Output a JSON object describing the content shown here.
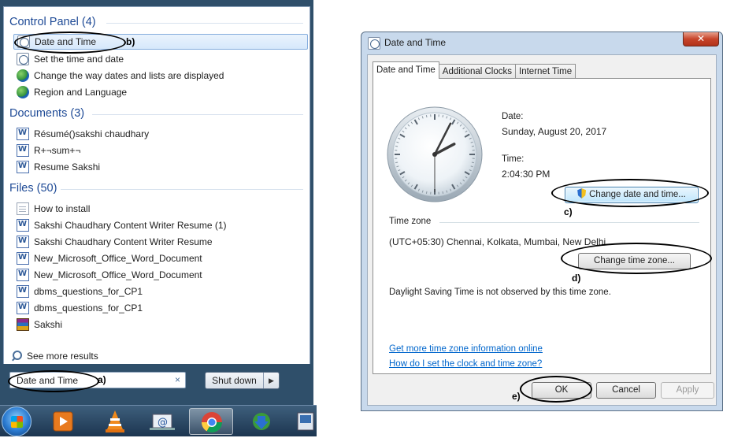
{
  "start_menu": {
    "sections": {
      "control_panel": {
        "heading": "Control Panel (4)",
        "items": [
          {
            "label": "Date and Time",
            "icon": "clock-icon"
          },
          {
            "label": "Set the time and date",
            "icon": "clock-icon"
          },
          {
            "label": "Change the way dates and lists are displayed",
            "icon": "globe-icon"
          },
          {
            "label": "Region and Language",
            "icon": "globe-icon"
          }
        ]
      },
      "documents": {
        "heading": "Documents (3)",
        "items": [
          {
            "label": "Résumé()sakshi chaudhary",
            "icon": "word-doc-icon"
          },
          {
            "label": "R+¬sum+¬",
            "icon": "word-doc-icon"
          },
          {
            "label": "Resume Sakshi",
            "icon": "word-doc-icon"
          }
        ]
      },
      "files": {
        "heading": "Files (50)",
        "items": [
          {
            "label": "How to install",
            "icon": "text-doc-icon"
          },
          {
            "label": "Sakshi Chaudhary Content Writer Resume (1)",
            "icon": "word-doc-icon"
          },
          {
            "label": "Sakshi Chaudhary Content Writer Resume",
            "icon": "word-doc-icon"
          },
          {
            "label": "New_Microsoft_Office_Word_Document",
            "icon": "word-doc-icon"
          },
          {
            "label": "New_Microsoft_Office_Word_Document",
            "icon": "word-doc-icon"
          },
          {
            "label": "dbms_questions_for_CP1",
            "icon": "word-doc-icon"
          },
          {
            "label": "dbms_questions_for_CP1",
            "icon": "word-doc-icon"
          },
          {
            "label": "Sakshi",
            "icon": "winrar-archive-icon"
          }
        ]
      }
    },
    "see_more": "See more results",
    "search_value": "Date and Time",
    "search_clear": "×",
    "shutdown_label": "Shut down",
    "shutdown_arrow": "▶"
  },
  "taskbar": {
    "buttons": [
      "start-orb",
      "media-player-icon",
      "vlc-icon",
      "mail-icon",
      "chrome-icon",
      "download-manager-icon",
      "app-icon"
    ]
  },
  "dialog": {
    "title": "Date and Time",
    "close": "✕",
    "tabs": [
      "Date and Time",
      "Additional Clocks",
      "Internet Time"
    ],
    "date_label": "Date:",
    "date_value": "Sunday, August 20, 2017",
    "time_label": "Time:",
    "time_value": "2:04:30 PM",
    "change_date_time_button": "Change date and time...",
    "timezone_label": "Time zone",
    "timezone_value": "(UTC+05:30) Chennai, Kolkata, Mumbai, New Delhi",
    "change_timezone_button": "Change time zone...",
    "dst_text": "Daylight Saving Time is not observed by this time zone.",
    "link_more_info": "Get more time zone information online",
    "link_how_to": "How do I set the clock and time zone?",
    "ok": "OK",
    "cancel": "Cancel",
    "apply": "Apply",
    "clock_time": {
      "hours": 2,
      "minutes": 4,
      "seconds": 30
    }
  },
  "annotations": [
    "a)",
    "b)",
    "c)",
    "d)",
    "e)"
  ],
  "colors": {
    "heading_blue": "#1e4a96",
    "link_blue": "#0066cc",
    "taskbar": "#2f4f6a"
  }
}
